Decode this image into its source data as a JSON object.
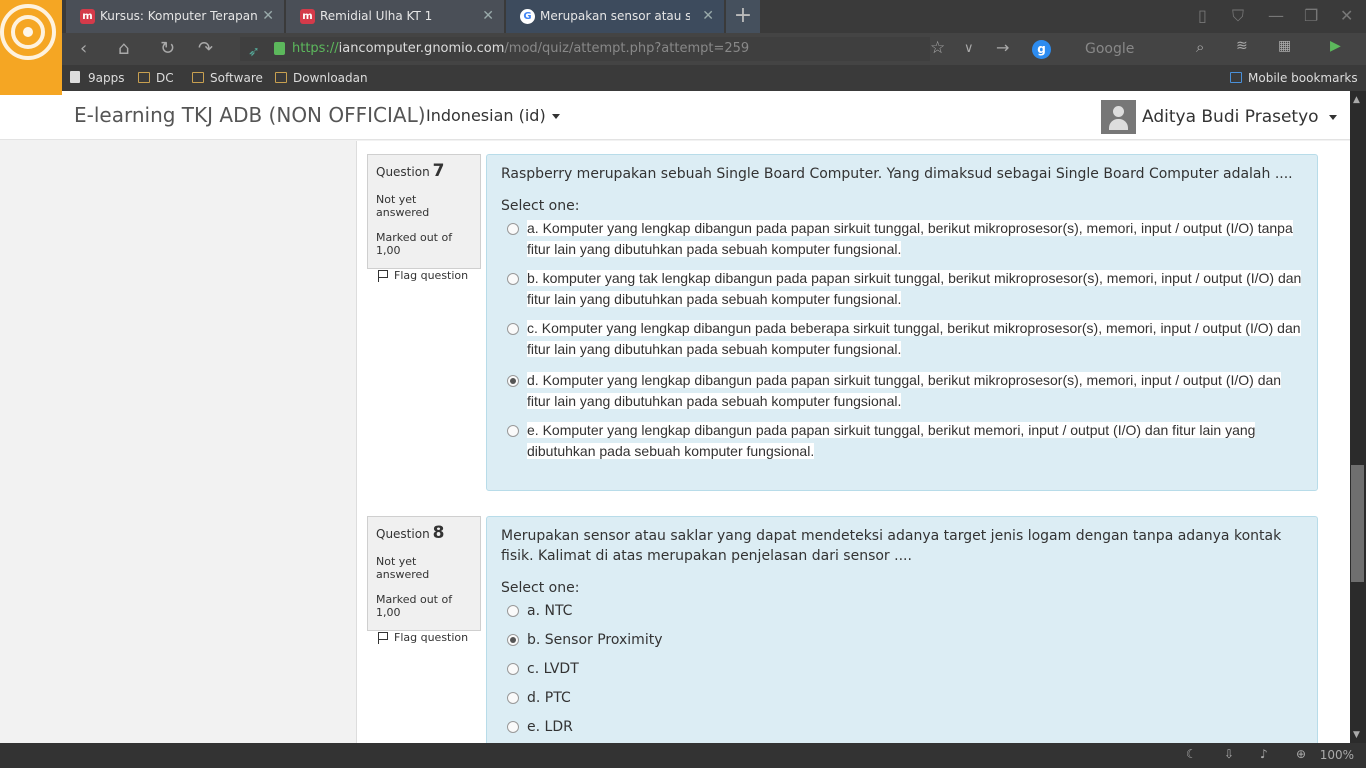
{
  "tabs": [
    {
      "title": "Kursus: Komputer Terapan",
      "favicon": "m"
    },
    {
      "title": "Remidial Ulha KT 1",
      "favicon": "m"
    },
    {
      "title": "Merupakan sensor atau sakl",
      "favicon": "G"
    }
  ],
  "address": {
    "scheme": "https://",
    "host": "iancomputer.gnomio.com",
    "path": "/mod/quiz/attempt.php?attempt=259"
  },
  "search": {
    "placeholder": "Google"
  },
  "bookmarks": [
    "9apps",
    "DC",
    "Software",
    "Downloadan"
  ],
  "mobile_bookmarks": "Mobile bookmarks",
  "site": {
    "brand": "E-learning TKJ ADB (NON OFFICIAL)",
    "language": "Indonesian (id)",
    "user": "Aditya Budi Prasetyo"
  },
  "questions": [
    {
      "label": "Question",
      "number": "7",
      "state": "Not yet answered",
      "marks": "Marked out of 1,00",
      "flag": "Flag question",
      "text": "Raspberry merupakan sebuah Single Board Computer. Yang dimaksud sebagai Single Board Computer adalah ....",
      "select": "Select one:",
      "options": [
        "a. Komputer yang lengkap dibangun pada papan sirkuit tunggal, berikut mikroprosesor(s), memori, input / output (I/O) tanpa fitur lain yang dibutuhkan pada sebuah komputer fungsional.",
        "b. komputer yang tak lengkap dibangun pada papan sirkuit tunggal, berikut mikroprosesor(s), memori, input / output (I/O) dan fitur lain yang dibutuhkan pada sebuah komputer fungsional.",
        "c. Komputer yang lengkap dibangun pada beberapa sirkuit tunggal, berikut mikroprosesor(s), memori, input / output (I/O) dan fitur lain yang dibutuhkan pada sebuah komputer fungsional.",
        "d. Komputer yang lengkap dibangun pada papan sirkuit tunggal, berikut mikroprosesor(s), memori, input / output (I/O) dan fitur lain yang dibutuhkan pada sebuah komputer fungsional.",
        "e. Komputer yang lengkap dibangun pada papan sirkuit tunggal, berikut  memori, input / output (I/O) dan fitur lain yang dibutuhkan pada sebuah komputer fungsional."
      ],
      "selected_index": 3
    },
    {
      "label": "Question",
      "number": "8",
      "state": "Not yet answered",
      "marks": "Marked out of 1,00",
      "flag": "Flag question",
      "text": "Merupakan sensor atau saklar yang dapat mendeteksi adanya target jenis logam dengan tanpa adanya kontak fisik. Kalimat di atas merupakan penjelasan dari sensor ....",
      "select": "Select one:",
      "options": [
        "a. NTC",
        "b. Sensor Proximity",
        "c. LVDT",
        "d. PTC",
        "e. LDR"
      ],
      "selected_index": 1
    }
  ],
  "status": {
    "zoom": "100%"
  },
  "colors": {
    "accent": "#5cb85c",
    "question_bg": "#dcedf4",
    "tab_favicon": "#d43a4a"
  }
}
